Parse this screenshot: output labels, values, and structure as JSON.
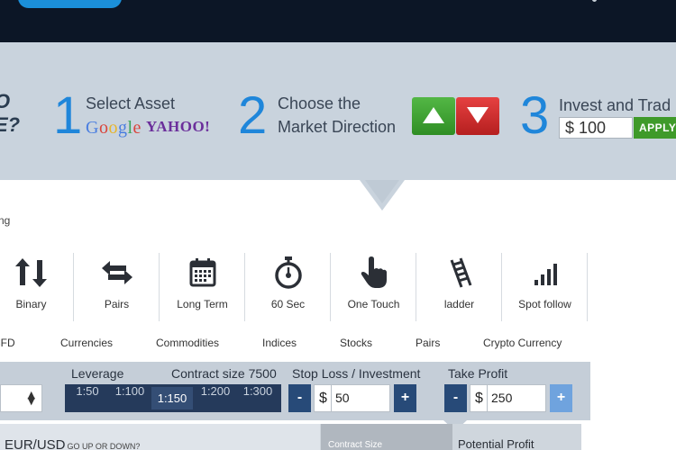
{
  "steps": {
    "left_partial": [
      "O",
      "E?"
    ],
    "step1": {
      "number": "1",
      "title": "Select Asset",
      "google": "Google",
      "yahoo": "YAHOO!"
    },
    "step2": {
      "number": "2",
      "line1": "Choose the",
      "line2": "Market Direction"
    },
    "step3": {
      "number": "3",
      "title": "Invest and Trad",
      "currency": "$",
      "amount": "100",
      "apply_label": "APPLY"
    }
  },
  "breadcrumb": "ng",
  "trade_types": [
    {
      "label": "Binary",
      "icon": "up-down-arrows-icon"
    },
    {
      "label": "Pairs",
      "icon": "left-right-arrows-icon"
    },
    {
      "label": "Long Term",
      "icon": "calendar-icon"
    },
    {
      "label": "60 Sec",
      "icon": "stopwatch-icon"
    },
    {
      "label": "One Touch",
      "icon": "pointer-hand-icon"
    },
    {
      "label": "ladder",
      "icon": "ladder-icon"
    },
    {
      "label": "Spot follow",
      "icon": "signal-bars-icon"
    }
  ],
  "categories": [
    "CFD",
    "Currencies",
    "Commodities",
    "Indices",
    "Stocks",
    "Pairs",
    "Crypto Currency"
  ],
  "controls": {
    "leverage_label": "Leverage",
    "contract_size_label": "Contract size 7500",
    "leverage_options": [
      "1:50",
      "1:100",
      "1:150",
      "1:200",
      "1:300"
    ],
    "leverage_selected": "1:150",
    "stop_loss_label": "Stop Loss / Investment",
    "stop_loss_value": "50",
    "take_profit_label": "Take Profit",
    "take_profit_value": "250",
    "currency": "$",
    "minus": "-",
    "plus": "+"
  },
  "bottom": {
    "pair": "EUR/USD",
    "pair_question": "GO UP OR DOWN?",
    "contract_size": "Contract Size",
    "potential_profit": "Potential Profit"
  },
  "colors": {
    "navy": "#0c1626",
    "band": "#c9d3dd",
    "accent_blue": "#1f86da",
    "up_green": "#3f9a2a",
    "down_red": "#d32f2f",
    "leverage_bg": "#253a5b"
  }
}
